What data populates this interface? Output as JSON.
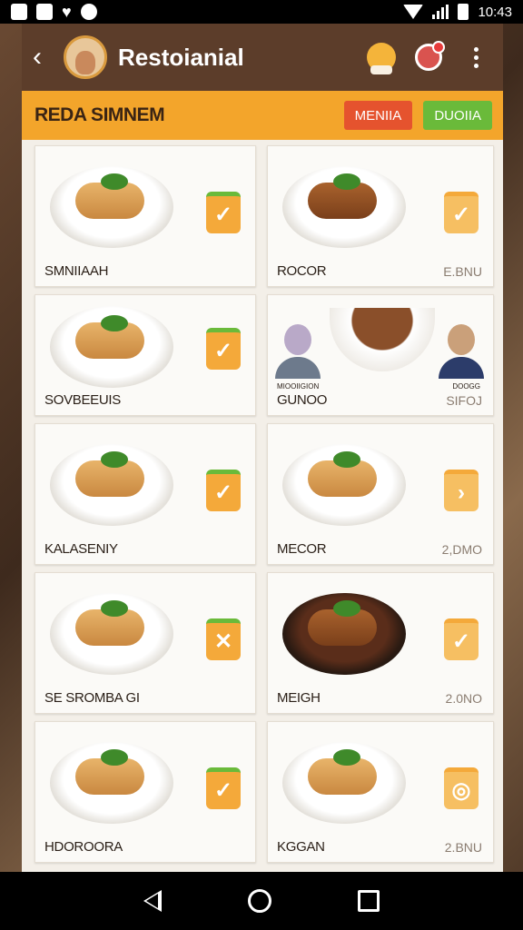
{
  "status_bar": {
    "time": "10:43"
  },
  "toolbar": {
    "title": "Restoianial"
  },
  "subbar": {
    "title": "REDA SIMNEM",
    "menu_button": "MENIIA",
    "order_button": "DUOIIA"
  },
  "menu_items": [
    {
      "name": "SMNIIAAH",
      "price": ""
    },
    {
      "name": "ROCOR",
      "price": "E.BNU"
    },
    {
      "name": "SOVBEEUIS",
      "price": ""
    },
    {
      "name": "GUNOO",
      "price": "SIFOJ",
      "left_person_caption": "MIOOIIGION",
      "right_person_caption": "DOOGG"
    },
    {
      "name": "KALASENIY",
      "price": ""
    },
    {
      "name": "MECOR",
      "price": "2,DMO"
    },
    {
      "name": "SE SROMBA GI",
      "price": ""
    },
    {
      "name": "MEIGH",
      "price": "2.0NO"
    },
    {
      "name": "HDOROORA",
      "price": ""
    },
    {
      "name": "KGGAN",
      "price": "2.BNU"
    }
  ],
  "colors": {
    "toolbar": "#5c3d2a",
    "subbar": "#f3a52b",
    "menu_button": "#e5532e",
    "order_button": "#6aba3a",
    "check_box": "#f4a93a"
  }
}
